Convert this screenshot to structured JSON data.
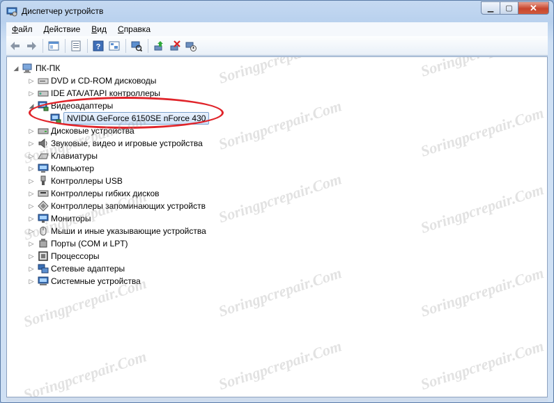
{
  "window": {
    "title": "Диспетчер устройств"
  },
  "menu": [
    {
      "label": "Файл",
      "accel": "Ф",
      "rest": "айл"
    },
    {
      "label": "Действие",
      "accel": "Д",
      "rest": "ействие"
    },
    {
      "label": "Вид",
      "accel": "В",
      "rest": "ид"
    },
    {
      "label": "Справка",
      "accel": "С",
      "rest": "правка"
    }
  ],
  "toolbar": {
    "icons": [
      "back-icon",
      "forward-icon",
      "console-tree-icon",
      "properties-icon",
      "help-icon",
      "tree-view-icon",
      "scan-hardware-icon",
      "update-driver-icon",
      "uninstall-icon",
      "disable-icon"
    ]
  },
  "tree": {
    "root": "ПК-ПК",
    "categories": [
      {
        "label": "DVD и CD-ROM дисководы",
        "icon": "dvd-drive-icon",
        "expanded": false
      },
      {
        "label": "IDE ATA/ATAPI контроллеры",
        "icon": "ide-controller-icon",
        "expanded": false
      },
      {
        "label": "Видеоадаптеры",
        "icon": "display-adapter-icon",
        "expanded": true,
        "children": [
          {
            "label": "NVIDIA GeForce 6150SE nForce 430",
            "icon": "display-adapter-icon",
            "selected": true
          }
        ]
      },
      {
        "label": "Дисковые устройства",
        "icon": "disk-drive-icon",
        "expanded": false
      },
      {
        "label": "Звуковые, видео и игровые устройства",
        "icon": "sound-icon",
        "expanded": false
      },
      {
        "label": "Клавиатуры",
        "icon": "keyboard-icon",
        "expanded": false
      },
      {
        "label": "Компьютер",
        "icon": "computer-icon",
        "expanded": false
      },
      {
        "label": "Контроллеры USB",
        "icon": "usb-icon",
        "expanded": false
      },
      {
        "label": "Контроллеры гибких дисков",
        "icon": "floppy-controller-icon",
        "expanded": false
      },
      {
        "label": "Контроллеры запоминающих устройств",
        "icon": "storage-controller-icon",
        "expanded": false
      },
      {
        "label": "Мониторы",
        "icon": "monitor-icon",
        "expanded": false
      },
      {
        "label": "Мыши и иные указывающие устройства",
        "icon": "mouse-icon",
        "expanded": false
      },
      {
        "label": "Порты (COM и LPT)",
        "icon": "port-icon",
        "expanded": false
      },
      {
        "label": "Процессоры",
        "icon": "processor-icon",
        "expanded": false
      },
      {
        "label": "Сетевые адаптеры",
        "icon": "network-adapter-icon",
        "expanded": false
      },
      {
        "label": "Системные устройства",
        "icon": "system-device-icon",
        "expanded": false
      }
    ]
  },
  "watermark": "Soringpcrepair.Com",
  "colors": {
    "highlight": "#e0242a",
    "selection": "#cfe1f8"
  }
}
